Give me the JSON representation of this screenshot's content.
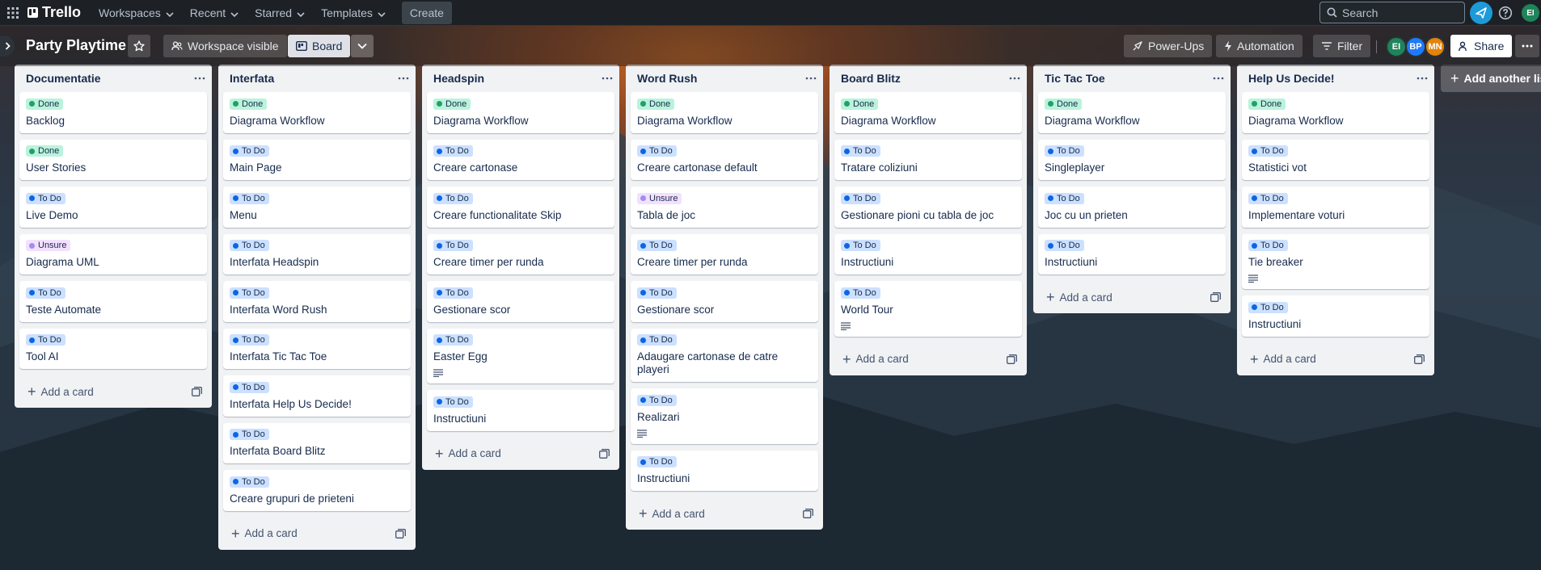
{
  "app": {
    "name": "Trello",
    "nav": {
      "workspaces": "Workspaces",
      "recent": "Recent",
      "starred": "Starred",
      "templates": "Templates",
      "create": "Create",
      "search_placeholder": "Search"
    },
    "user_initials": "EI"
  },
  "board": {
    "title": "Party Playtime",
    "visibility": "Workspace visible",
    "view": "Board",
    "power_ups": "Power-Ups",
    "automation": "Automation",
    "filter": "Filter",
    "share": "Share",
    "members": [
      "EI",
      "BP",
      "MN"
    ],
    "add_list": "Add another list"
  },
  "labels": {
    "done": "Done",
    "todo": "To Do",
    "unsure": "Unsure"
  },
  "add_card_label": "Add a card",
  "lists": [
    {
      "title": "Documentatie",
      "cards": [
        {
          "label": "Done",
          "title": "Backlog"
        },
        {
          "label": "Done",
          "title": "User Stories"
        },
        {
          "label": "To Do",
          "title": "Live Demo"
        },
        {
          "label": "Unsure",
          "title": "Diagrama UML"
        },
        {
          "label": "To Do",
          "title": "Teste Automate"
        },
        {
          "label": "To Do",
          "title": "Tool AI"
        }
      ]
    },
    {
      "title": "Interfata",
      "cards": [
        {
          "label": "Done",
          "title": "Diagrama Workflow"
        },
        {
          "label": "To Do",
          "title": "Main Page"
        },
        {
          "label": "To Do",
          "title": "Menu"
        },
        {
          "label": "To Do",
          "title": "Interfata Headspin"
        },
        {
          "label": "To Do",
          "title": "Interfata Word Rush"
        },
        {
          "label": "To Do",
          "title": "Interfata Tic Tac Toe"
        },
        {
          "label": "To Do",
          "title": "Interfata Help Us Decide!"
        },
        {
          "label": "To Do",
          "title": "Interfata Board Blitz"
        },
        {
          "label": "To Do",
          "title": "Creare grupuri de prieteni"
        }
      ]
    },
    {
      "title": "Headspin",
      "cards": [
        {
          "label": "Done",
          "title": "Diagrama Workflow"
        },
        {
          "label": "To Do",
          "title": "Creare cartonase"
        },
        {
          "label": "To Do",
          "title": "Creare functionalitate Skip"
        },
        {
          "label": "To Do",
          "title": "Creare timer per runda"
        },
        {
          "label": "To Do",
          "title": "Gestionare scor"
        },
        {
          "label": "To Do",
          "title": "Easter Egg",
          "description": true
        },
        {
          "label": "To Do",
          "title": "Instructiuni"
        }
      ]
    },
    {
      "title": "Word Rush",
      "cards": [
        {
          "label": "Done",
          "title": "Diagrama Workflow"
        },
        {
          "label": "To Do",
          "title": "Creare cartonase default"
        },
        {
          "label": "Unsure",
          "title": "Tabla de joc"
        },
        {
          "label": "To Do",
          "title": "Creare timer per runda"
        },
        {
          "label": "To Do",
          "title": "Gestionare scor"
        },
        {
          "label": "To Do",
          "title": "Adaugare cartonase de catre playeri"
        },
        {
          "label": "To Do",
          "title": "Realizari",
          "description": true
        },
        {
          "label": "To Do",
          "title": "Instructiuni"
        }
      ]
    },
    {
      "title": "Board Blitz",
      "cards": [
        {
          "label": "Done",
          "title": "Diagrama Workflow"
        },
        {
          "label": "To Do",
          "title": "Tratare coliziuni"
        },
        {
          "label": "To Do",
          "title": "Gestionare pioni cu tabla de joc"
        },
        {
          "label": "To Do",
          "title": "Instructiuni"
        },
        {
          "label": "To Do",
          "title": "World Tour",
          "description": true
        }
      ]
    },
    {
      "title": "Tic Tac Toe",
      "cards": [
        {
          "label": "Done",
          "title": "Diagrama Workflow"
        },
        {
          "label": "To Do",
          "title": "Singleplayer"
        },
        {
          "label": "To Do",
          "title": "Joc cu un prieten"
        },
        {
          "label": "To Do",
          "title": "Instructiuni"
        }
      ]
    },
    {
      "title": "Help Us Decide!",
      "cards": [
        {
          "label": "Done",
          "title": "Diagrama Workflow"
        },
        {
          "label": "To Do",
          "title": "Statistici vot"
        },
        {
          "label": "To Do",
          "title": "Implementare voturi"
        },
        {
          "label": "To Do",
          "title": "Tie breaker",
          "description": true
        },
        {
          "label": "To Do",
          "title": "Instructiuni"
        }
      ]
    }
  ]
}
